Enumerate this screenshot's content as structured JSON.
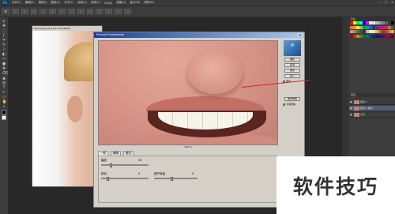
{
  "menubar": {
    "logo": "Ps",
    "items": [
      "文件(F)",
      "编辑(E)",
      "图像(I)",
      "图层(L)",
      "文字(Y)",
      "选择(S)",
      "滤镜(T)",
      "3D(D)",
      "视图(V)",
      "窗口(W)",
      "帮助(H)"
    ],
    "window_controls": [
      "–",
      "□",
      "✕"
    ]
  },
  "optbar": {
    "items": [
      "▣",
      "□",
      "□",
      "□",
      "□",
      "◰",
      "□",
      "□",
      "□",
      "□",
      "□",
      "□",
      "□",
      "□"
    ]
  },
  "toolbar": {
    "tools": [
      "▸",
      "✥",
      "⬚",
      "ʃ",
      "⌗",
      "✎",
      "⌇",
      "◐",
      "✂",
      "●",
      "✚",
      "⌫",
      "▲",
      "◍",
      "T",
      "↖",
      "▭",
      "✋",
      "⌕"
    ],
    "fg_color": "#000000",
    "bg_color": "#ffffff"
  },
  "document": {
    "tab": "Portrait.jpg @ 33.3% (RGB/8#)"
  },
  "dialog": {
    "title": "Portrait Professional",
    "close": "✕",
    "logo_text": "PP",
    "zoom": "100 %",
    "buttons": [
      "确定",
      "取消",
      "保存",
      "载入"
    ],
    "checkbox_label": "预览",
    "bottom_button": "重置参数",
    "radio_label": "平滑皮肤",
    "tabs": [
      "一般",
      "眼睛",
      "嘴巴"
    ],
    "sliders": [
      {
        "label": "磨皮",
        "value": "50",
        "level": 0.18
      },
      {
        "label": "锐化",
        "value": "0",
        "level": 0.1
      },
      {
        "label": "细节保留",
        "value": "0",
        "level": 0.4
      }
    ]
  },
  "panels": {
    "swatches_header": "色板",
    "layers_header": "图层",
    "layers": [
      {
        "name": "图层 1",
        "selected": false
      },
      {
        "name": "图层 1 副本",
        "selected": true
      },
      {
        "name": "背景",
        "selected": false
      }
    ],
    "swatch_colors": [
      "#ff0000",
      "#ffff00",
      "#00ff00",
      "#00ffff",
      "#0000ff",
      "#ff00ff",
      "#ffffff",
      "#e0e0e0",
      "#c0c0c0",
      "#a0a0a0",
      "#808080",
      "#606060",
      "#404040",
      "#000000",
      "#f26c4f",
      "#f7941d",
      "#fff200",
      "#8dc63f",
      "#00a651",
      "#00a99d",
      "#0072bc",
      "#2e3192",
      "#662d91",
      "#92278f",
      "#ec008c",
      "#ed145b",
      "#a67c52",
      "#754c24",
      "#c69c6d",
      "#998675",
      "#736357",
      "#534741",
      "#362f2d",
      "#c7b299",
      "#ffe5b4",
      "#f5deb3",
      "#deb887",
      "#d2691e",
      "#8b4513",
      "#a0522d",
      "#cd853f",
      "#f4a460",
      "#9e0b0f",
      "#a0410d",
      "#aba000",
      "#598527",
      "#007236",
      "#00746b",
      "#004a80",
      "#003471",
      "#1b1464",
      "#440e62",
      "#630460",
      "#9e005d",
      "#9e0039",
      "#790000"
    ]
  },
  "watermark": {
    "text": "软件技巧"
  }
}
